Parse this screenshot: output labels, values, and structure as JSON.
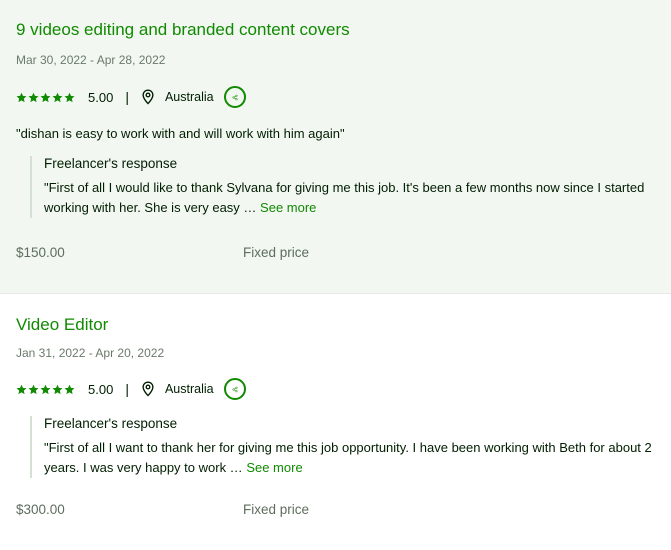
{
  "jobs": [
    {
      "title": "9 videos editing and branded content covers",
      "dates": "Mar 30, 2022 - Apr 28, 2022",
      "score": "5.00",
      "separator": "|",
      "country": "Australia",
      "client_feedback": "\"dishan is easy to work with and will work with him again\"",
      "response_heading": "Freelancer's response",
      "response_text": "\"First of all I would like to thank Sylvana for giving me this job. It's been a few months now since I started working with her. She is very easy …",
      "see_more": "See more",
      "price": "$150.00",
      "price_type": "Fixed price"
    },
    {
      "title": "Video Editor",
      "dates": "Jan 31, 2022 - Apr 20, 2022",
      "score": "5.00",
      "separator": "|",
      "country": "Australia",
      "response_heading": "Freelancer's response",
      "response_text": "\"First of all I want to thank her for giving me this job opportunity. I have been working with Beth for about 2 years. I was very happy to work …",
      "see_more": "See more",
      "price": "$300.00",
      "price_type": "Fixed price"
    }
  ],
  "icons": {
    "star": "star-icon",
    "location": "location-pin-icon",
    "share": "share-icon"
  },
  "colors": {
    "accent": "#108a00",
    "highlight_bg": "#f2f7f2",
    "text": "#001e00",
    "muted": "#5e6d5e"
  }
}
